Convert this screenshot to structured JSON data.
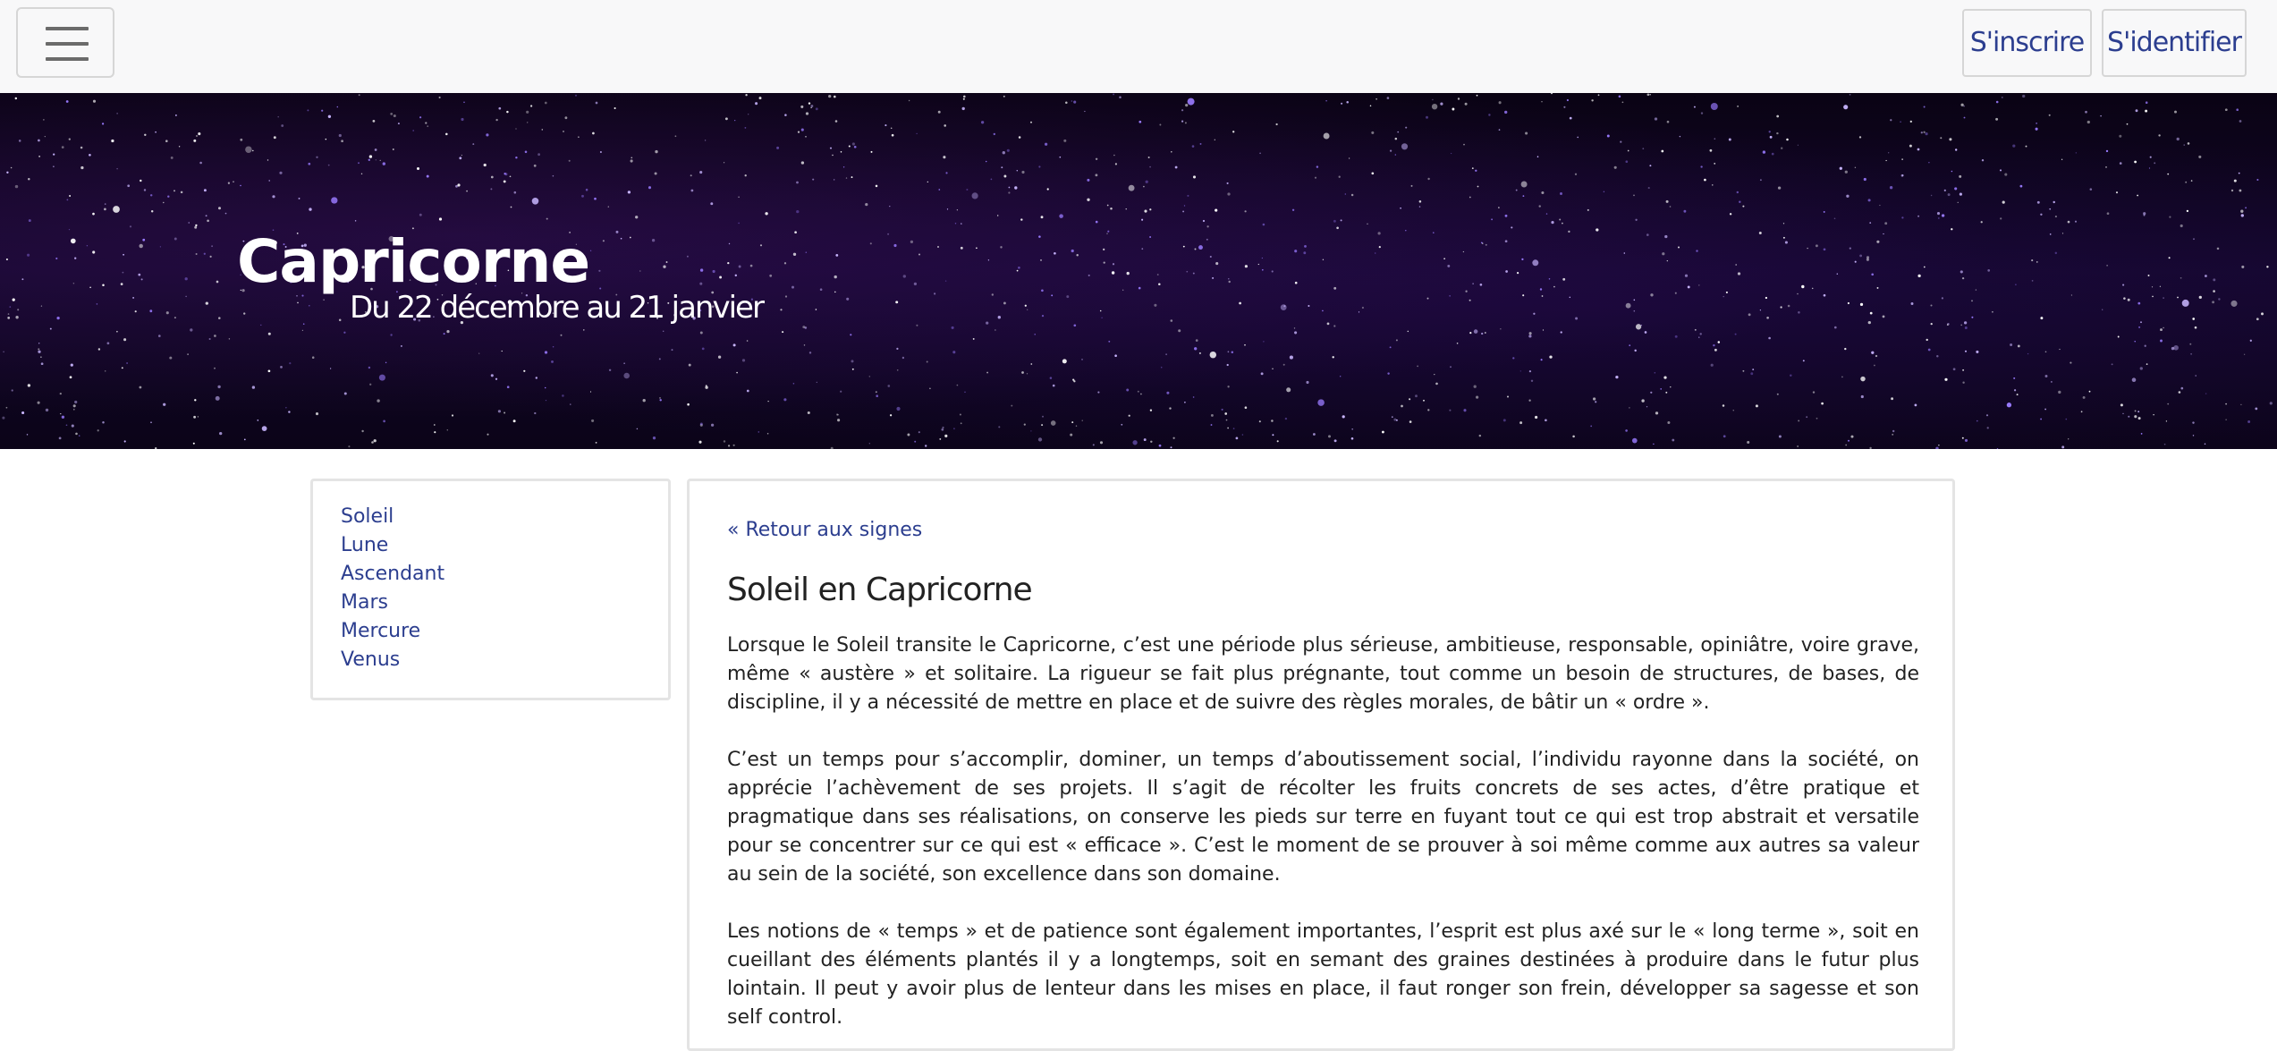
{
  "nav": {
    "signup_label": "S'inscrire",
    "login_label": "S'identifier"
  },
  "hero": {
    "title": "Capricorne",
    "subtitle": "Du 22 décembre au 21 janvier"
  },
  "sidebar": {
    "items": [
      {
        "label": "Soleil"
      },
      {
        "label": "Lune"
      },
      {
        "label": "Ascendant"
      },
      {
        "label": "Mars"
      },
      {
        "label": "Mercure"
      },
      {
        "label": "Venus"
      }
    ]
  },
  "main": {
    "back_link": "« Retour aux signes",
    "title": "Soleil en Capricorne",
    "paragraphs": [
      "Lorsque le Soleil transite le Capricorne, c’est une période plus sérieuse, ambitieuse, responsable, opiniâtre, voire grave, même « austère » et solitaire. La rigueur se fait plus prégnante, tout comme un besoin de structures, de bases, de discipline, il y a nécessité de mettre en place et de suivre des règles morales, de bâtir un « ordre ».",
      "C’est un temps pour s’accomplir, dominer, un temps d’aboutissement social, l’individu rayonne dans la société, on apprécie l’achèvement de ses projets. Il s’agit de récolter les fruits concrets de ses actes, d’être pratique et pragmatique dans ses réalisations, on conserve les pieds sur terre en fuyant tout ce qui est trop abstrait et versatile pour se concentrer sur ce qui est « efficace ». C’est le moment de se prouver à soi même comme aux autres sa valeur au sein de la société, son excellence dans son domaine.",
      "Les notions de « temps » et de patience sont également importantes, l’esprit est plus axé sur le « long terme », soit en cueillant des éléments plantés il y a longtemps, soit en semant des graines destinées à produire dans le futur plus lointain. Il peut y avoir plus de lenteur dans les mises en place, il faut ronger son frein, développer sa sagesse et son self control."
    ]
  },
  "colors": {
    "link": "#2c3e8f",
    "hero_bg": "#0a0314"
  },
  "icons": {
    "menu": "hamburger-menu-icon"
  }
}
